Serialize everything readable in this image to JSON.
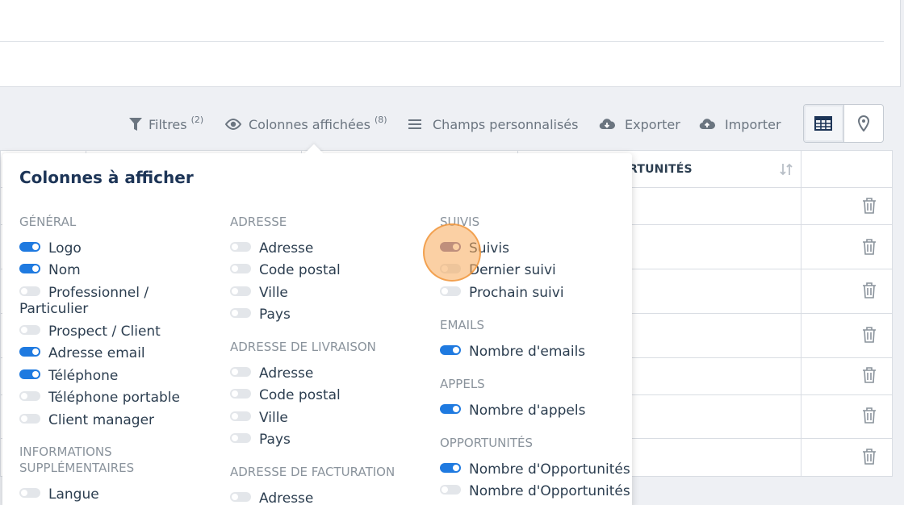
{
  "toolbar": {
    "filters": {
      "label": "Filtres",
      "count": "(2)"
    },
    "columns": {
      "label": "Colonnes affichées",
      "count": "(8)"
    },
    "custom_fields": {
      "label": "Champs personnalisés"
    },
    "export": {
      "label": "Exporter"
    },
    "import": {
      "label": "Importer"
    }
  },
  "view_switch": {
    "options": [
      "table-view",
      "map-view"
    ],
    "active": "table-view"
  },
  "table": {
    "visible_header": "RTUNITÉS"
  },
  "popover": {
    "title": "Colonnes à afficher",
    "groups": {
      "general": {
        "title": "GÉNÉRAL",
        "items": [
          {
            "label": "Logo",
            "on": true
          },
          {
            "label": "Nom",
            "on": true
          },
          {
            "label": "Professionnel /",
            "label2": "Particulier",
            "on": false
          },
          {
            "label": "Prospect / Client",
            "on": false
          },
          {
            "label": "Adresse email",
            "on": true
          },
          {
            "label": "Téléphone",
            "on": true
          },
          {
            "label": "Téléphone portable",
            "on": false
          },
          {
            "label": "Client manager",
            "on": false
          }
        ]
      },
      "infos": {
        "title1": "INFORMATIONS",
        "title2": "SUPPLÉMENTAIRES",
        "items": [
          {
            "label": "Langue",
            "on": false
          }
        ]
      },
      "adresse": {
        "title": "ADRESSE",
        "items": [
          {
            "label": "Adresse",
            "on": false
          },
          {
            "label": "Code postal",
            "on": false
          },
          {
            "label": "Ville",
            "on": false
          },
          {
            "label": "Pays",
            "on": false
          }
        ]
      },
      "livraison": {
        "title": "ADRESSE DE LIVRAISON",
        "items": [
          {
            "label": "Adresse",
            "on": false
          },
          {
            "label": "Code postal",
            "on": false
          },
          {
            "label": "Ville",
            "on": false
          },
          {
            "label": "Pays",
            "on": false
          }
        ]
      },
      "facturation": {
        "title": "ADRESSE DE FACTURATION",
        "items": [
          {
            "label": "Adresse",
            "on": false
          }
        ]
      },
      "suivis": {
        "title": "SUIVIS",
        "items": [
          {
            "label": "Suivis",
            "on": true
          },
          {
            "label": "Dernier suivi",
            "on": false
          },
          {
            "label": "Prochain suivi",
            "on": false
          }
        ]
      },
      "emails": {
        "title": "EMAILS",
        "items": [
          {
            "label": "Nombre d'emails",
            "on": true
          }
        ]
      },
      "appels": {
        "title": "APPELS",
        "items": [
          {
            "label": "Nombre d'appels",
            "on": true
          }
        ]
      },
      "opportunites": {
        "title": "OPPORTUNITÉS",
        "items": [
          {
            "label": "Nombre d'Opportunités",
            "on": true
          },
          {
            "label": "Nombre d'Opportunités",
            "on": false
          }
        ]
      }
    }
  },
  "colors": {
    "accent": "#1f7ae0",
    "toggle_off": "#e3e6ea",
    "muted_text": "#8a939c",
    "title": "#1d3557"
  }
}
